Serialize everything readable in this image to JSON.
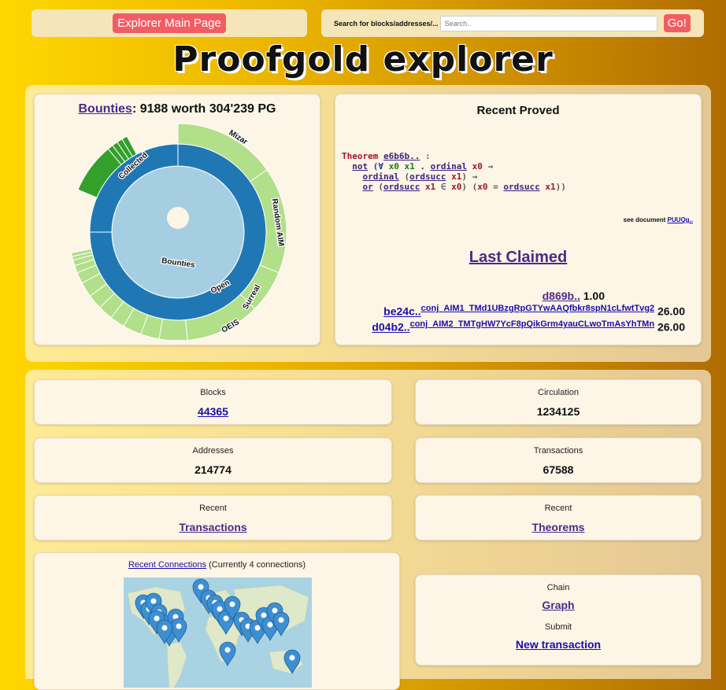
{
  "nav": {
    "main_button": "Explorer Main Page"
  },
  "search": {
    "label": "Search for blocks/addresses/...",
    "placeholder": "Search..",
    "go_label": "Go!"
  },
  "title": "Proofgold explorer",
  "bounties": {
    "link": "Bounties",
    "summary": ": 9188 worth 304'239 PG",
    "sunburst_labels": [
      "Collected",
      "Bounties",
      "Open",
      "Mizar",
      "Random AIM",
      "Surreal",
      "OEIS"
    ]
  },
  "recent_proved": {
    "heading": "Recent Proved",
    "theorem_kw": "Theorem",
    "theorem_id": "e6b6b..",
    "doc_prefix": "see document",
    "doc_link": "PUUQg.."
  },
  "last_claimed": {
    "heading": "Last Claimed",
    "entries": [
      {
        "id": "d869b..",
        "conj": "",
        "amount": "1.00"
      },
      {
        "id": "be24c..",
        "conj": "conj_AIM1_TMd1UBzgRpGTYwAAQfbkr8spN1cLfwtTvg2",
        "amount": "26.00"
      },
      {
        "id": "d04b2..",
        "conj": "conj_AIM2_TMTgHW7YcF8pQikGrm4yauCLwoTmAsYhTMn",
        "amount": "26.00"
      }
    ]
  },
  "stats": {
    "blocks": {
      "label": "Blocks",
      "value": "44365"
    },
    "circulation": {
      "label": "Circulation",
      "value": "1234125"
    },
    "addresses": {
      "label": "Addresses",
      "value": "214774"
    },
    "transactions": {
      "label": "Transactions",
      "value": "67588"
    },
    "recent_tx": {
      "label": "Recent",
      "link": "Transactions"
    },
    "recent_thm": {
      "label": "Recent",
      "link": "Theorems"
    }
  },
  "connections": {
    "link": "Recent Connections",
    "suffix": " (Currently 4 connections)"
  },
  "chain": {
    "label": "Chain",
    "link": "Graph",
    "submit_label": "Submit",
    "submit_link": "New transaction"
  },
  "colors": {
    "button_red": "#f25d63",
    "link_purple": "#4b2a88",
    "sunburst_dark": "#1f78b4",
    "sunburst_light": "#a6cee3",
    "sunburst_green": "#b2df8a",
    "sunburst_darkgreen": "#33a02c"
  }
}
